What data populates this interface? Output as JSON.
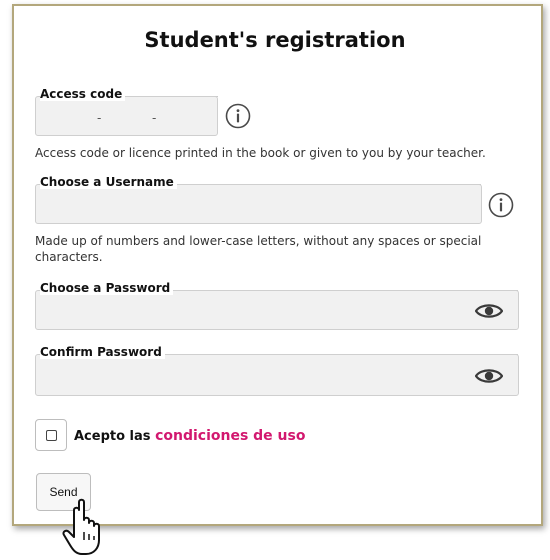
{
  "form": {
    "title": "Student's registration",
    "access_code": {
      "label": "Access code",
      "separator_1": "-",
      "separator_2": "-",
      "help": "Access code or licence printed in the book or given to you by your teacher."
    },
    "username": {
      "label": "Choose a Username",
      "help": "Made up of numbers and lower-case letters, without any spaces or special characters."
    },
    "password": {
      "label": "Choose a Password"
    },
    "confirm_password": {
      "label": "Confirm Password"
    },
    "terms": {
      "prefix": "Acepto las",
      "link": "condiciones de uso"
    },
    "send_label": "Send"
  },
  "colors": {
    "panel_border": "#b3a77c",
    "field_background": "#f1f1f1",
    "link": "#d2186f"
  },
  "icons": {
    "info": "info-icon",
    "eye": "eye-icon",
    "cursor": "hand-pointer-cursor-icon"
  }
}
